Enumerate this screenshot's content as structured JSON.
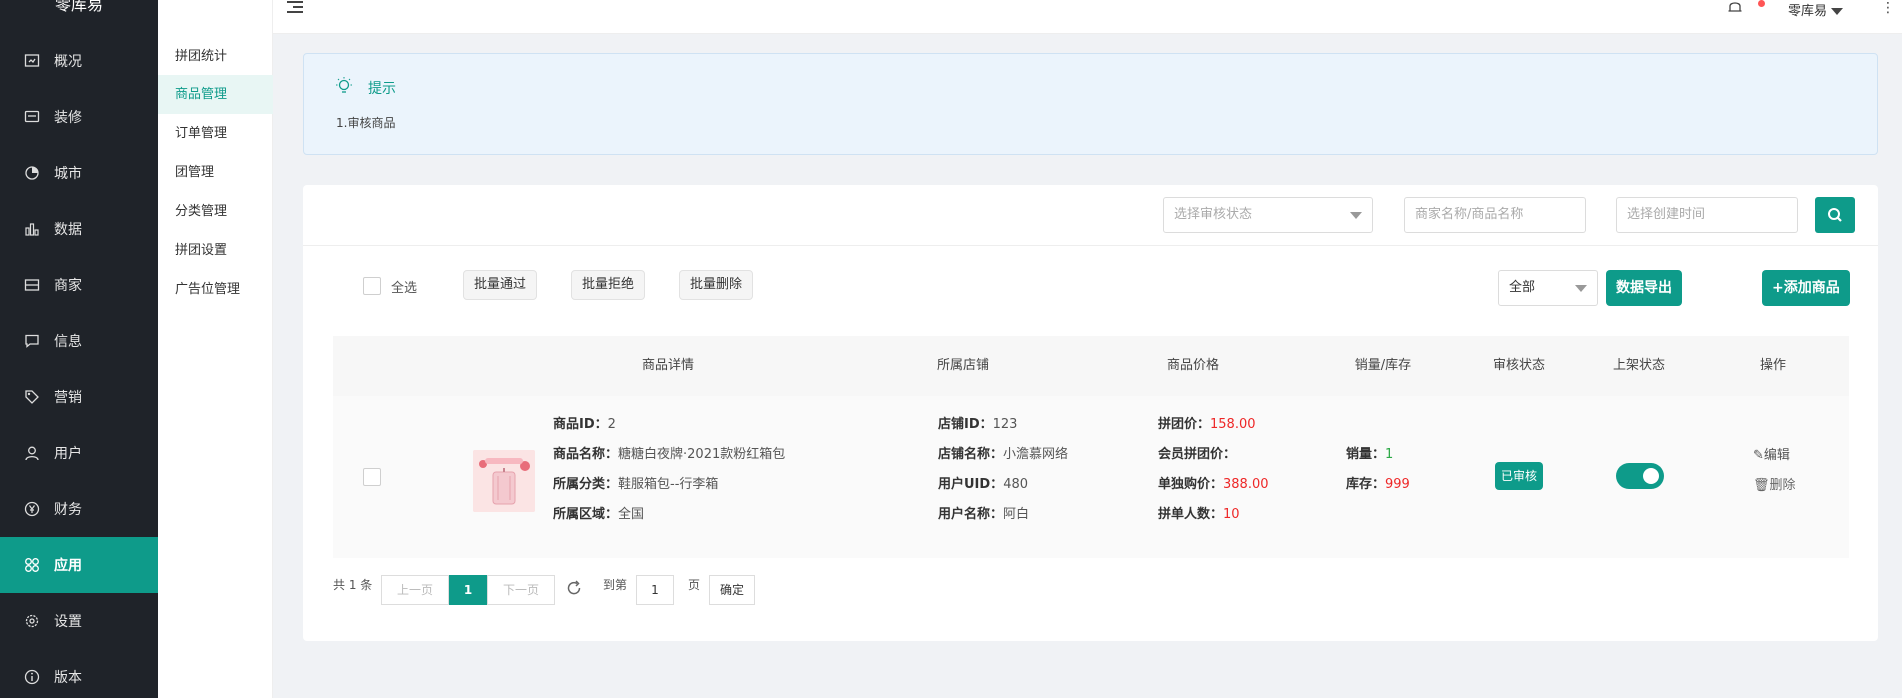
{
  "app": {
    "brand": "零库易"
  },
  "sidebar": {
    "items": [
      {
        "label": "概况",
        "icon": "overview-icon"
      },
      {
        "label": "装修",
        "icon": "decorate-icon"
      },
      {
        "label": "城市",
        "icon": "city-icon"
      },
      {
        "label": "数据",
        "icon": "chart-icon"
      },
      {
        "label": "商家",
        "icon": "shop-icon"
      },
      {
        "label": "信息",
        "icon": "message-icon"
      },
      {
        "label": "营销",
        "icon": "tag-icon"
      },
      {
        "label": "用户",
        "icon": "user-icon"
      },
      {
        "label": "财务",
        "icon": "yen-icon"
      },
      {
        "label": "应用",
        "icon": "apps-icon",
        "active": true
      },
      {
        "label": "设置",
        "icon": "gear-icon"
      },
      {
        "label": "版本",
        "icon": "info-icon"
      }
    ]
  },
  "subnav": {
    "items": [
      {
        "label": "拼团统计"
      },
      {
        "label": "商品管理",
        "active": true
      },
      {
        "label": "订单管理"
      },
      {
        "label": "团管理"
      },
      {
        "label": "分类管理"
      },
      {
        "label": "拼团设置"
      },
      {
        "label": "广告位管理"
      }
    ]
  },
  "topbar": {
    "user_name": "零库易",
    "more": "⋮"
  },
  "tips": {
    "title": "提示",
    "text": "1.审核商品"
  },
  "filters": {
    "status_placeholder": "选择审核状态",
    "keyword_placeholder": "商家名称/商品名称",
    "date_placeholder": "选择创建时间"
  },
  "actions": {
    "select_all": "全选",
    "batch_pass": "批量通过",
    "batch_reject": "批量拒绝",
    "batch_delete": "批量删除",
    "scope_value": "全部",
    "export": "数据导出",
    "add": "+添加商品"
  },
  "table": {
    "headers": [
      "商品详情",
      "所属店铺",
      "商品价格",
      "销量/库存",
      "审核状态",
      "上架状态",
      "操作"
    ],
    "row": {
      "goods_id_label": "商品ID：",
      "goods_id": "2",
      "goods_name_label": "商品名称：",
      "goods_name": "糖糖白夜牌·2021款粉红箱包",
      "category_label": "所属分类：",
      "category": "鞋服箱包--行李箱",
      "region_label": "所属区域：",
      "region": "全国",
      "shop_id_label": "店铺ID：",
      "shop_id": "123",
      "shop_name_label": "店铺名称：",
      "shop_name": "小澹慕网络",
      "uid_label": "用户UID：",
      "uid": "480",
      "user_name_label": "用户名称：",
      "user_name": "阿白",
      "group_price_label": "拼团价：",
      "group_price": "158.00",
      "member_price_label": "会员拼团价：",
      "member_price": "",
      "single_price_label": "单独购价：",
      "single_price": "388.00",
      "group_size_label": "拼单人数：",
      "group_size": "10",
      "sales_label": "销量：",
      "sales": "1",
      "stock_label": "库存：",
      "stock": "999",
      "audit_status": "已审核",
      "edit": "编辑",
      "delete": "删除"
    }
  },
  "pager": {
    "total": "共 1 条",
    "prev": "上一页",
    "current": "1",
    "next": "下一页",
    "goto_label": "到第",
    "goto_value": "1",
    "page_unit": "页",
    "confirm": "确定"
  }
}
